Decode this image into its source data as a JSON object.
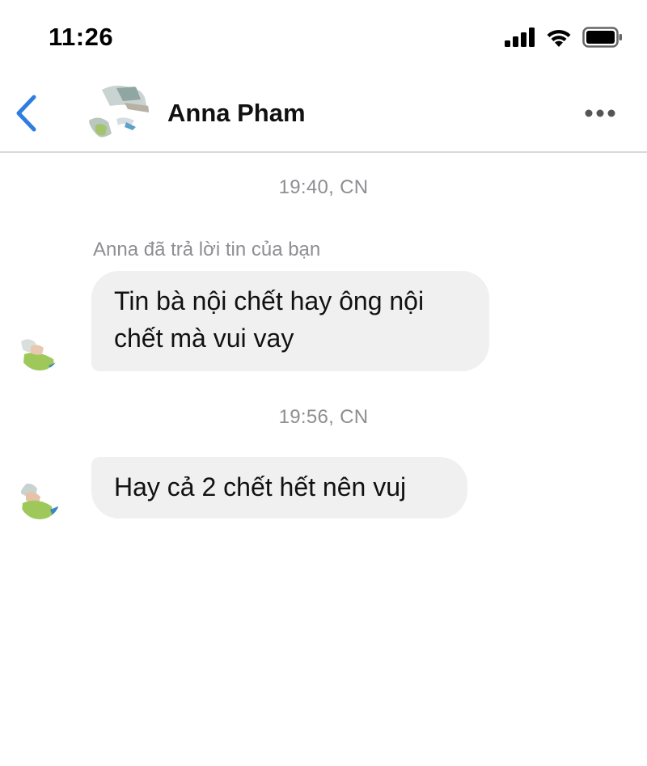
{
  "status_bar": {
    "time": "11:26",
    "icons": [
      "cellular-signal-icon",
      "wifi-icon",
      "battery-icon"
    ]
  },
  "header": {
    "back_icon": "chevron-left-icon",
    "contact_name": "Anna Pham",
    "more_icon": "ellipsis-icon"
  },
  "conversation": {
    "groups": [
      {
        "timestamp": "19:40, CN",
        "reply_note": "Anna đã trả lời tin của bạn",
        "message_lines": [
          "Tin bà nội chết hay ông nội",
          "chết mà vui vay"
        ]
      },
      {
        "timestamp": "19:56, CN",
        "message_lines": [
          "Hay cả 2 chết hết nên vuj"
        ]
      }
    ]
  },
  "colors": {
    "accent": "#2f7de1",
    "bubble": "#f0f0f0",
    "meta_text": "#8e8e93",
    "divider": "#d9d9d9"
  }
}
